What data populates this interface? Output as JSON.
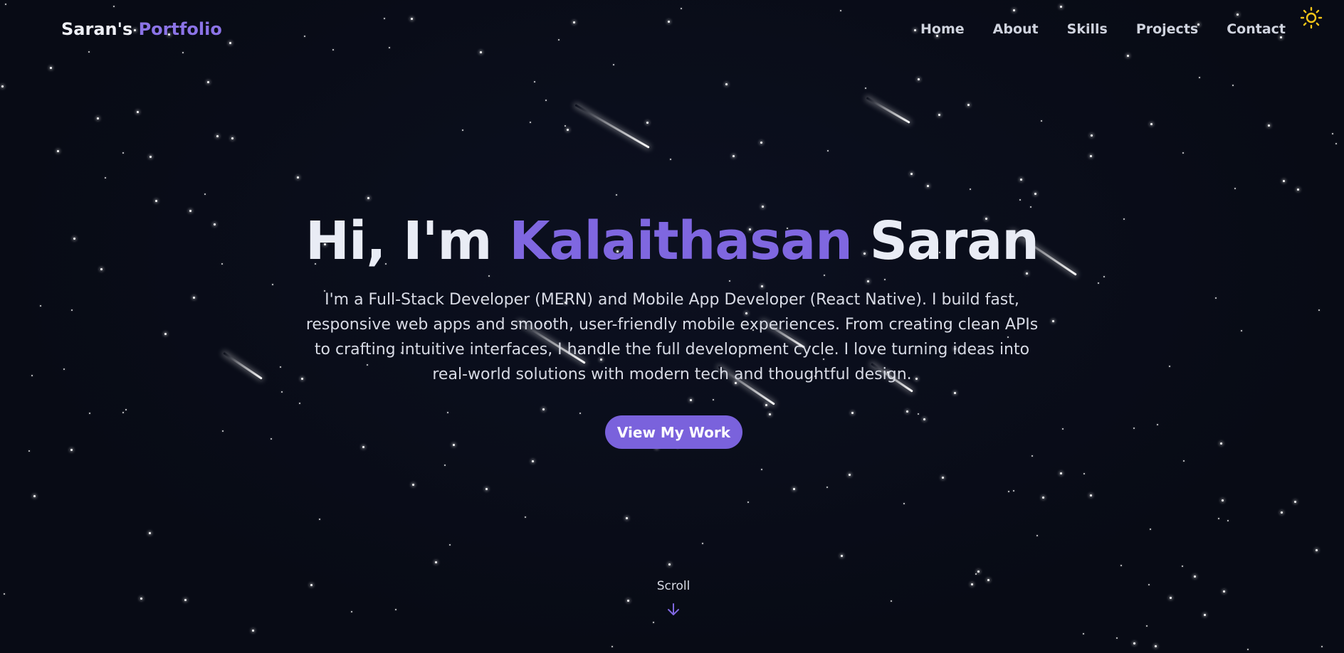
{
  "header": {
    "brand_first": "Saran's",
    "brand_accent": "Portfolio",
    "nav": [
      "Home",
      "About",
      "Skills",
      "Projects",
      "Contact"
    ],
    "theme_icon": "sun-icon"
  },
  "hero": {
    "greeting": "Hi, I'm",
    "first_name": "Kalaithasan",
    "last_name": "Saran",
    "bio": "I'm a Full-Stack Developer (MERN) and Mobile App Developer (React Native). I build fast, responsive web apps and smooth, user-friendly mobile experiences. From creating clean APIs to crafting intuitive interfaces, I handle the full development cycle. I love turning ideas into real-world solutions with modern tech and thoughtful design.",
    "cta": "View My Work",
    "scroll_label": "Scroll",
    "scroll_icon": "arrow-down-icon"
  },
  "colors": {
    "background": "#090c17",
    "accent": "#7f67e0",
    "button": "#7a62dc",
    "sun": "#f5c518"
  }
}
